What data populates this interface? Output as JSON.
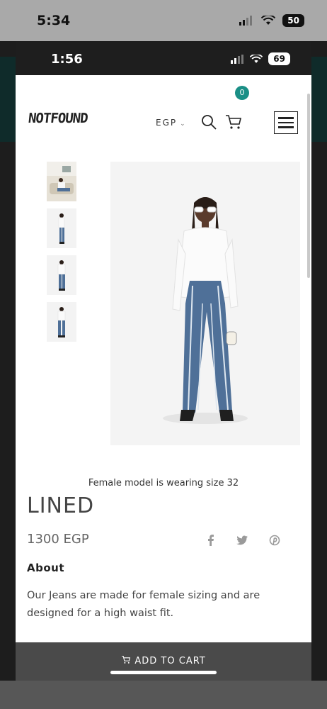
{
  "outer_status": {
    "time": "5:34",
    "battery": "50"
  },
  "inner_status": {
    "time": "1:56",
    "battery": "69"
  },
  "header": {
    "logo": "NOTFOUND",
    "currency": "EGP",
    "cart_count": "0"
  },
  "product": {
    "model_caption": "Female model is wearing size 32",
    "title": "LINED",
    "price": "1300 EGP",
    "about_heading": "About",
    "about_text": "Our Jeans are made for female sizing and are designed for a high waist fit."
  },
  "share_icons": [
    "facebook-icon",
    "twitter-icon",
    "pinterest-icon"
  ],
  "cart_bar": {
    "label": "ADD TO CART"
  },
  "colors": {
    "accent": "#1a8f86",
    "cart_bar": "#4a4a4a",
    "denim": "#4f7098"
  }
}
